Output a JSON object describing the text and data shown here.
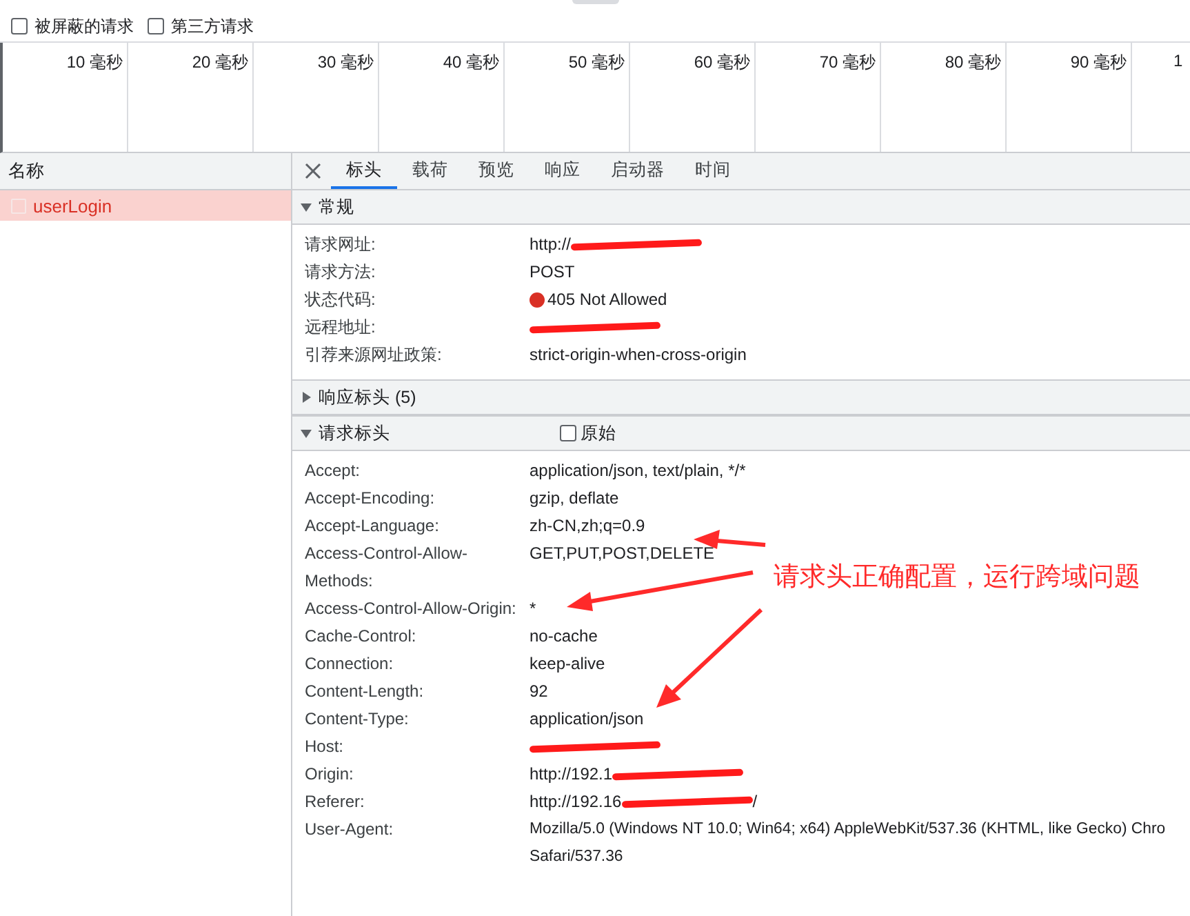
{
  "filters": [
    {
      "label": "被屏蔽的请求",
      "checked": false
    },
    {
      "label": "第三方请求",
      "checked": false
    }
  ],
  "timeline": {
    "ticks": [
      "10 毫秒",
      "20 毫秒",
      "30 毫秒",
      "40 毫秒",
      "50 毫秒",
      "60 毫秒",
      "70 毫秒",
      "80 毫秒",
      "90 毫秒",
      "1"
    ]
  },
  "request_list": {
    "header": "名称",
    "items": [
      {
        "name": "userLogin",
        "selected": true,
        "failed": true
      }
    ]
  },
  "detail_tabs": [
    {
      "label": "标头",
      "selected": true
    },
    {
      "label": "载荷",
      "selected": false
    },
    {
      "label": "预览",
      "selected": false
    },
    {
      "label": "响应",
      "selected": false
    },
    {
      "label": "启动器",
      "selected": false
    },
    {
      "label": "时间",
      "selected": false
    }
  ],
  "sections": [
    {
      "title": "常规",
      "expanded": true,
      "rows": [
        {
          "key": "请求网址:",
          "value": "http://",
          "redacted": true
        },
        {
          "key": "请求方法:",
          "value": "POST"
        },
        {
          "key": "状态代码:",
          "value": "405 Not Allowed",
          "color": "#d93025"
        },
        {
          "key": "远程地址:",
          "redacted": true
        },
        {
          "key": "引荐来源网址政策:",
          "value": "strict-origin-when-cross-origin"
        }
      ]
    },
    {
      "title": "响应标头 (5)",
      "expanded": false
    },
    {
      "title": "请求标头",
      "expanded": true,
      "raw_toggle": {
        "label": "原始",
        "checked": false
      },
      "rows": [
        {
          "key": "Accept:",
          "value": "application/json, text/plain, */*"
        },
        {
          "key": "Accept-Encoding:",
          "value": "gzip, deflate"
        },
        {
          "key": "Accept-Language:",
          "value": "zh-CN,zh;q=0.9"
        },
        {
          "key": "Access-Control-Allow-Methods:",
          "value": "GET,PUT,POST,DELETE"
        },
        {
          "key": "Access-Control-Allow-Origin:",
          "value": "*"
        },
        {
          "key": "Cache-Control:",
          "value": "no-cache"
        },
        {
          "key": "Connection:",
          "value": "keep-alive"
        },
        {
          "key": "Content-Length:",
          "value": "92"
        },
        {
          "key": "Content-Type:",
          "value": "application/json"
        },
        {
          "key": "Host:",
          "redacted": true
        },
        {
          "key": "Origin:",
          "value": "http://192.1",
          "redacted": true
        },
        {
          "key": "Referer:",
          "value": "http://192.16",
          "redacted": true,
          "value_after": "/"
        },
        {
          "key": "User-Agent:",
          "value": "Mozilla/5.0 (Windows NT 10.0; Win64; x64) AppleWebKit/537.36 (KHTML, like Gecko) Chro",
          "value_line_2": "Safari/537.36"
        }
      ]
    }
  ],
  "annotation": {
    "text": "请求头正确配置，运行跨域问题"
  }
}
